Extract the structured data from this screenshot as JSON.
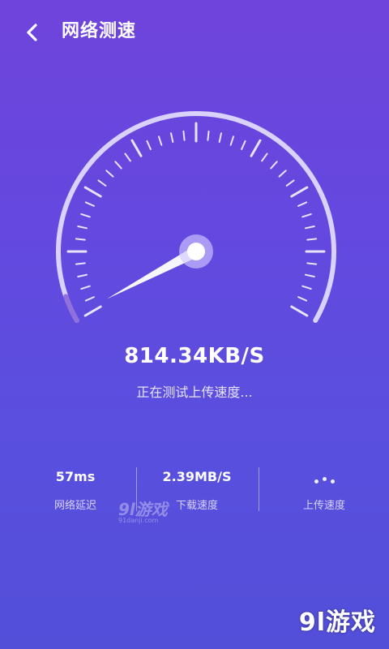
{
  "header": {
    "title": "网络测速"
  },
  "speed": {
    "value": "814.34KB/S",
    "status": "正在测试上传速度..."
  },
  "stats": [
    {
      "value": "57ms",
      "label": "网络延迟"
    },
    {
      "value": "2.39MB/S",
      "label": "下载速度"
    },
    {
      "value": "",
      "label": "上传速度"
    }
  ],
  "watermark": {
    "brand": "9l游戏",
    "domain": "91danji.com",
    "corner": "9l游戏"
  }
}
